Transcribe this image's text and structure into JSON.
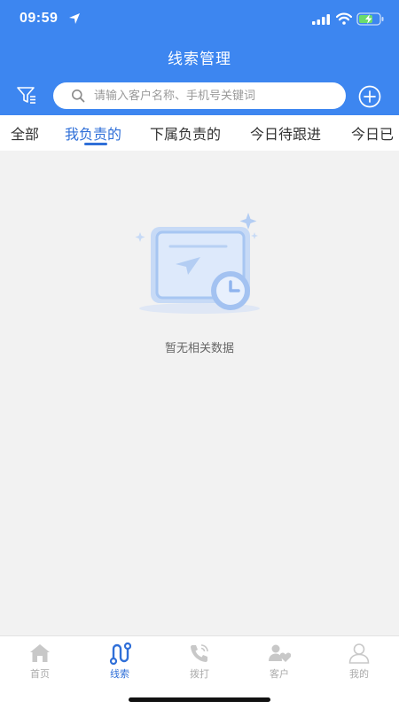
{
  "status_bar": {
    "time": "09:59"
  },
  "header": {
    "title": "线索管理"
  },
  "search": {
    "placeholder": "请输入客户名称、手机号关键词",
    "value": ""
  },
  "tabs": [
    {
      "label": "全部",
      "active": false
    },
    {
      "label": "我负责的",
      "active": true
    },
    {
      "label": "下属负责的",
      "active": false
    },
    {
      "label": "今日待跟进",
      "active": false
    },
    {
      "label": "今日已",
      "active": false
    }
  ],
  "empty_state": {
    "message": "暂无相关数据"
  },
  "bottom_nav": [
    {
      "label": "首页",
      "icon": "home-icon",
      "active": false
    },
    {
      "label": "线索",
      "icon": "route-icon",
      "active": true
    },
    {
      "label": "拨打",
      "icon": "phone-icon",
      "active": false
    },
    {
      "label": "客户",
      "icon": "customers-icon",
      "active": false
    },
    {
      "label": "我的",
      "icon": "profile-icon",
      "active": false
    }
  ],
  "colors": {
    "primary": "#3d86f0",
    "active": "#2f6fd8",
    "inactive": "#aaaaaa",
    "background": "#f2f2f2"
  }
}
